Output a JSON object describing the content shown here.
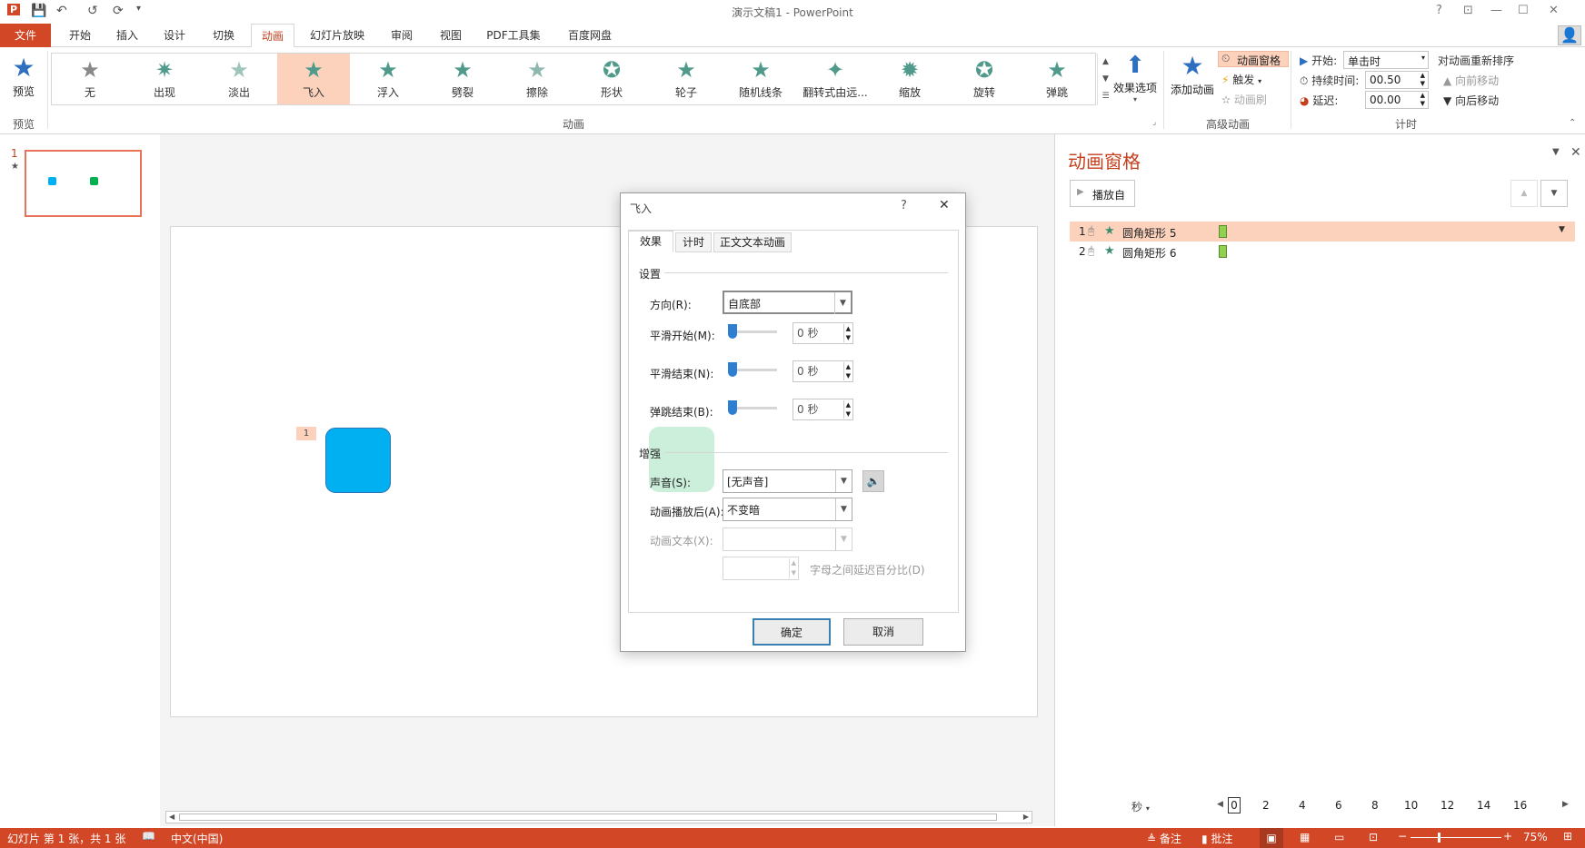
{
  "app": {
    "title": "演示文稿1 - PowerPoint"
  },
  "qat": {
    "ppt": "P",
    "save": "💾",
    "undo": "↶",
    "redo": "↺",
    "present": "⟳",
    "more": "▾"
  },
  "window_buttons": {
    "help": "?",
    "ribbon_opts": "⊡",
    "min": "—",
    "max": "☐",
    "close": "✕"
  },
  "tabs": [
    "文件",
    "开始",
    "插入",
    "设计",
    "切换",
    "动画",
    "幻灯片放映",
    "审阅",
    "视图",
    "PDF工具集",
    "百度网盘"
  ],
  "ribbon": {
    "preview": {
      "label": "预览",
      "group": "预览"
    },
    "gallery": [
      "无",
      "出现",
      "淡出",
      "飞入",
      "浮入",
      "劈裂",
      "擦除",
      "形状",
      "轮子",
      "随机线条",
      "翻转式由远...",
      "缩放",
      "旋转",
      "弹跳"
    ],
    "gallery_group": "动画",
    "effect_options": "效果选项",
    "add_animation": "添加动画",
    "advanced": {
      "pane": "动画窗格",
      "trigger": "触发",
      "painter": "动画刷",
      "group": "高级动画"
    },
    "timing": {
      "start_label": "开始:",
      "start_value": "单击时",
      "duration_label": "持续时间:",
      "duration_value": "00.50",
      "delay_label": "延迟:",
      "delay_value": "00.00",
      "reorder": "对动画重新排序",
      "forward": "向前移动",
      "backward": "向后移动",
      "group": "计时"
    }
  },
  "thumbs": {
    "number": "1",
    "star": "★"
  },
  "slide": {
    "anim_tag": "1"
  },
  "anim_pane": {
    "title": "动画窗格",
    "play_button": "播放自",
    "items": [
      {
        "num": "1",
        "name": "圆角矩形 5"
      },
      {
        "num": "2",
        "name": "圆角矩形 6"
      }
    ],
    "timeline": {
      "unit": "秒",
      "ticks": [
        "0",
        "2",
        "4",
        "6",
        "8",
        "10",
        "12",
        "14",
        "16"
      ]
    }
  },
  "dialog": {
    "title": "飞入",
    "help": "?",
    "close": "✕",
    "tabs": [
      "效果",
      "计时",
      "正文文本动画"
    ],
    "settings_section": "设置",
    "direction_label": "方向(R):",
    "direction_value": "自底部",
    "smooth_start_label": "平滑开始(M):",
    "smooth_end_label": "平滑结束(N):",
    "bounce_end_label": "弹跳结束(B):",
    "seconds_value": "0 秒",
    "enhance_section": "增强",
    "sound_label": "声音(S):",
    "sound_value": "[无声音]",
    "after_label": "动画播放后(A):",
    "after_value": "不变暗",
    "animate_text_label": "动画文本(X):",
    "delay_between_label": "字母之间延迟百分比(D)",
    "ok": "确定",
    "cancel": "取消"
  },
  "status": {
    "slide_info": "幻灯片 第 1 张，共 1 张",
    "language": "中文(中国)",
    "notes": "备注",
    "comments": "批注",
    "zoom": "75%"
  },
  "colors": {
    "accent": "#d24726",
    "shape_blue": "#00b0f0",
    "shape_green": "#00b050",
    "selected": "#fcd2bd"
  }
}
